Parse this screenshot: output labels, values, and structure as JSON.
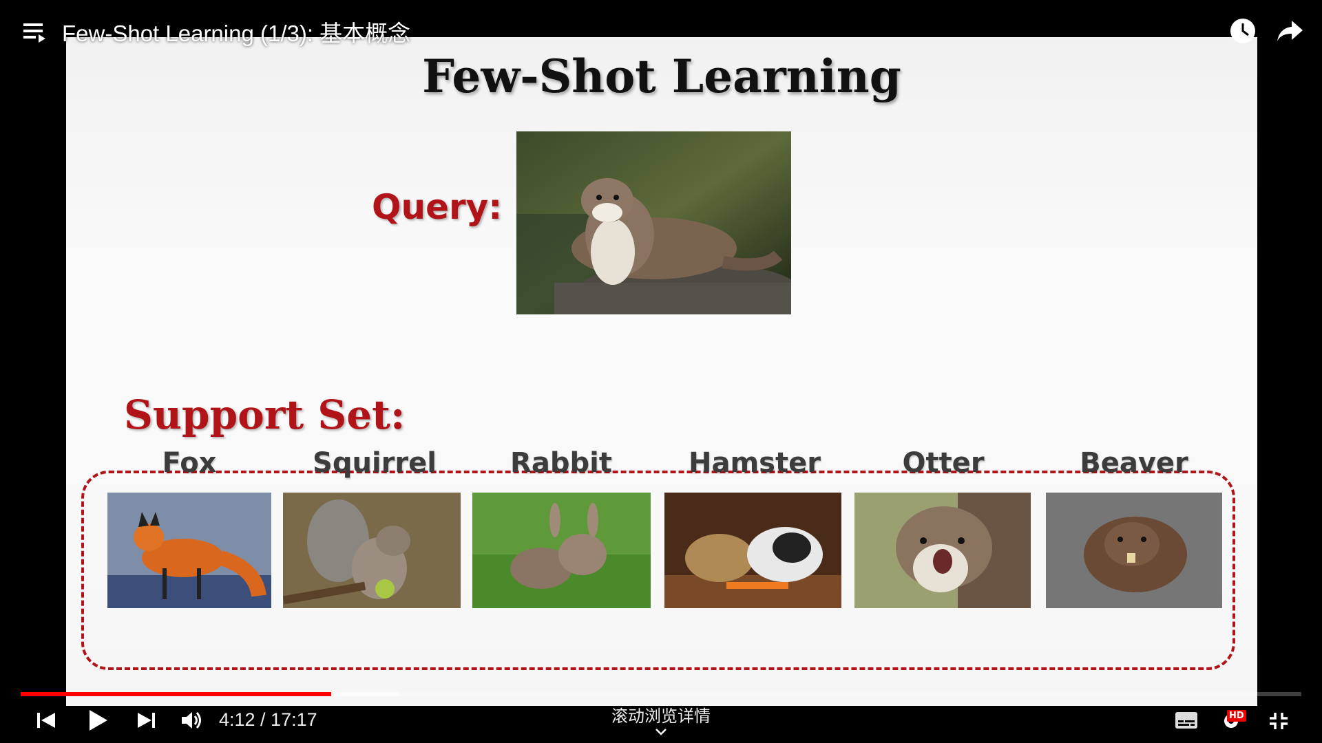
{
  "topbar": {
    "video_title": "Few-Shot Learning (1/3): 基本概念",
    "playlist_icon": "playlist-icon",
    "watch_later_icon": "clock-icon",
    "share_icon": "share-icon"
  },
  "slide": {
    "title": "Few-Shot Learning",
    "query_label": "Query:",
    "query_image": "otter on a log",
    "support_label": "Support Set:",
    "support_items": [
      {
        "name": "Fox"
      },
      {
        "name": "Squirrel"
      },
      {
        "name": "Rabbit"
      },
      {
        "name": "Hamster"
      },
      {
        "name": "Otter"
      },
      {
        "name": "Beaver"
      }
    ]
  },
  "player": {
    "time_display": "4:12 / 17:17",
    "scroll_hint": "滚动浏览详情",
    "played_fraction": 0.2426,
    "buffered_fraction": 0.2958,
    "hd_badge": "HD",
    "accent_color": "#ff0000"
  }
}
